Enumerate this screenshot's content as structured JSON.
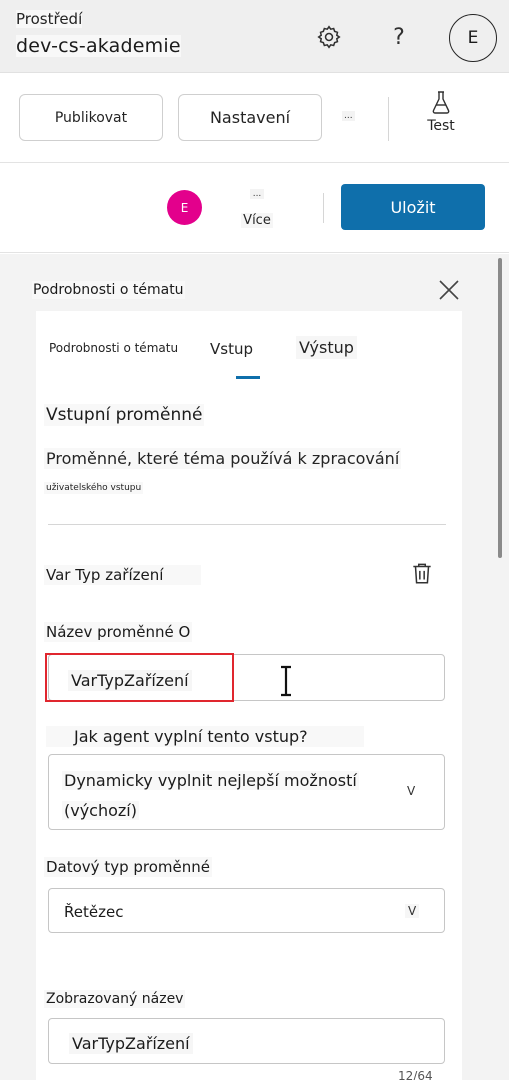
{
  "header": {
    "env_label": "Prostředí",
    "env_name": "dev-cs-akademie",
    "help_label": "?",
    "avatar_initial": "E"
  },
  "toolbar": {
    "publish_label": "Publikovat",
    "settings_label": "Nastavení",
    "more_label": "...",
    "test_label": "Test"
  },
  "savebar": {
    "avatar_initial": "E",
    "more_dots": "...",
    "more_label": "Více",
    "save_label": "Uložit"
  },
  "panel": {
    "title": "Podrobnosti o tématu",
    "tabs": [
      {
        "label": "Podrobnosti o tématu",
        "active": false
      },
      {
        "label": "Vstup",
        "active": true
      },
      {
        "label": "Výstup",
        "active": false
      }
    ],
    "section_title": "Vstupní proměnné",
    "section_desc_line1": "Proměnné, které téma používá k zpracování",
    "section_desc_line2": "uživatelského vstupu",
    "variable_header": "Var Typ zařízení",
    "name_label": "Název proměnné O",
    "name_value": "VarTypZařízení",
    "how_label": "Jak agent vyplní tento vstup?",
    "how_value_line1": "Dynamicky vyplnit nejlepší možností",
    "how_value_line2": "(výchozí)",
    "how_dropdown": "V",
    "type_label": "Datový typ proměnné",
    "type_value": "Řetězec",
    "type_dropdown": "V",
    "display_label": "Zobrazovaný název",
    "display_value": "VarTypZařízení",
    "char_counter": "12/64"
  },
  "colors": {
    "accent": "#0f6fab",
    "avatar_pink": "#e3008c",
    "highlight_red": "#e0262e"
  },
  "icons": [
    "gear-icon",
    "help-icon",
    "flask-icon",
    "close-icon",
    "trash-icon",
    "text-cursor-icon"
  ]
}
